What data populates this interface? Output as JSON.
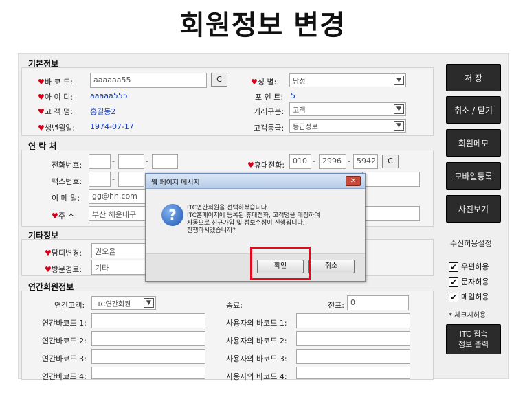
{
  "page_title": "회원정보 변경",
  "basic": {
    "title": "기본정보",
    "barcode_label": "바 코 드:",
    "barcode_value": "aaaaaa55",
    "barcode_btn": "C",
    "gender_label": "성    별:",
    "gender_value": "남성",
    "id_label": "아 이 디:",
    "id_value": "aaaaa555",
    "point_label": "포 인 트:",
    "point_value": "5",
    "name_label": "고 객 명:",
    "name_value": "홍길동2",
    "trade_label": "거래구분:",
    "trade_value": "고객",
    "birth_label": "생년월일:",
    "birth_value": "1974-07-17",
    "grade_label": "고객등급:",
    "grade_value": "등급정보"
  },
  "contact": {
    "title": "연 락 처",
    "phone_label": "전화번호:",
    "mobile_label": "휴대전화:",
    "mobile_1": "010",
    "mobile_2": "2996",
    "mobile_3": "5942",
    "mobile_btn": "C",
    "fax_label": "팩스번호:",
    "email_label": "이 메 일:",
    "email_value": "gg@hh.com",
    "addr_label": "주    소:",
    "addr_value": "부산 해운대구"
  },
  "etc": {
    "title": "기타정보",
    "manager_label": "담디변경:",
    "manager_value": "권오율",
    "visit_label": "방문경로:",
    "visit_value": "기타"
  },
  "linked": {
    "title": "연간회원정보",
    "customer_label": "연간고객:",
    "customer_value": "ITC연간회원",
    "end_label": "종료:",
    "ticket_label": "전표:",
    "ticket_value": "0",
    "rows": [
      {
        "left": "연간바코드 1:",
        "right": "사용자의 바코드 1:"
      },
      {
        "left": "연간바코드 2:",
        "right": "사용자의 바코드 2:"
      },
      {
        "left": "연간바코드 3:",
        "right": "사용자의 바코드 3:"
      },
      {
        "left": "연간바코드 4:",
        "right": "사용자의 바코드 4:"
      }
    ]
  },
  "right_buttons": {
    "save": "저 장",
    "cancel": "취소 / 닫기",
    "memo": "회원메모",
    "mobile": "모바일등록",
    "photo": "사진보기",
    "itc_line1": "ITC 접속",
    "itc_line2": "정보 출력"
  },
  "consent": {
    "title": "수신허용설정",
    "sms": "우편허용",
    "text": "문자허용",
    "email": "메일허용",
    "note": "* 체크시허용"
  },
  "dialog": {
    "title": "웹 페이지 메시지",
    "line1": "ITC연간회원을 선택하셨습니다.",
    "line2": "ITC홈페이지에 등록된 휴대전화, 고객명을 매칭하여",
    "line3": "자동으로 신규가입 및 정보수정이 진행됩니다.",
    "line4": "진행하시겠습니까?",
    "ok": "확인",
    "cancel": "취소"
  },
  "colors": {
    "heart": "#d0021b",
    "value_blue": "#1a3fb8",
    "highlight": "#e3091a"
  }
}
